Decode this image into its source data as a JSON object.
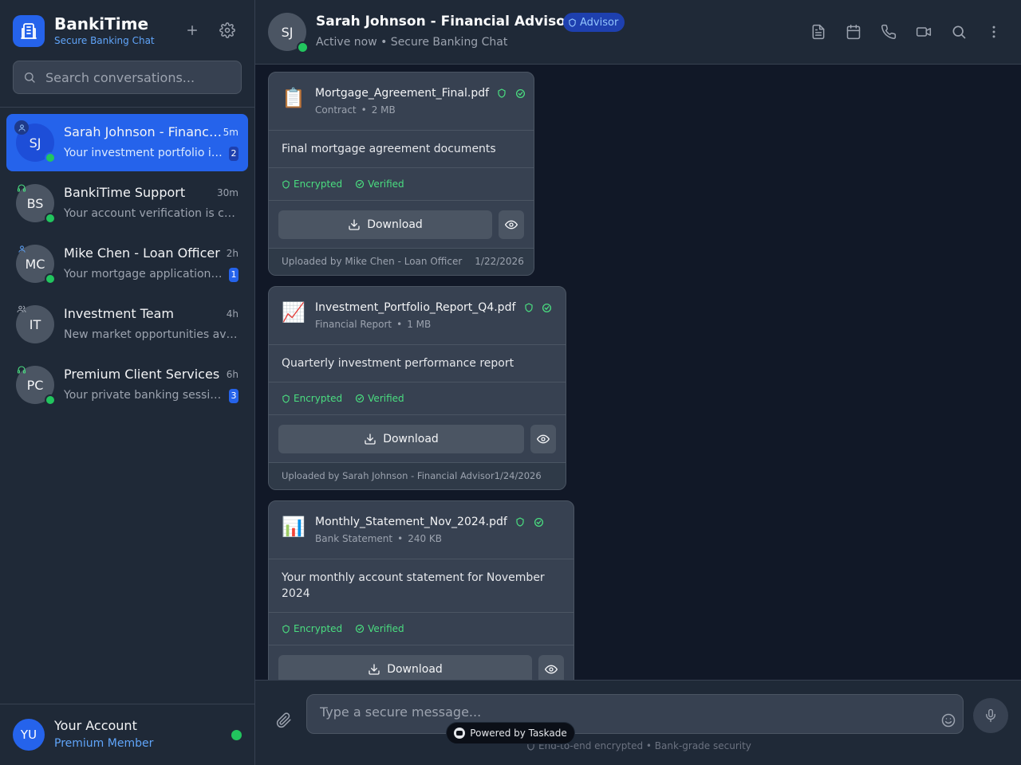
{
  "brand": {
    "name": "BankiTime",
    "subtitle": "Secure Banking Chat"
  },
  "search": {
    "placeholder": "Search conversations..."
  },
  "conversations": [
    {
      "initials": "SJ",
      "name": "Sarah Johnson - Financial Advisor",
      "time": "5m",
      "preview": "Your investment portfolio is performing well",
      "unread": "2",
      "role_icon": "user-icon",
      "online": true,
      "active": true
    },
    {
      "initials": "BS",
      "name": "BankiTime Support",
      "time": "30m",
      "preview": "Your account verification is complete",
      "unread": "",
      "role_icon": "headset-icon",
      "online": true,
      "active": false
    },
    {
      "initials": "MC",
      "name": "Mike Chen - Loan Officer",
      "time": "2h",
      "preview": "Your mortgage application has been received",
      "unread": "1",
      "role_icon": "user-icon",
      "online": true,
      "active": false
    },
    {
      "initials": "IT",
      "name": "Investment Team",
      "time": "4h",
      "preview": "New market opportunities available",
      "unread": "",
      "role_icon": "users-icon",
      "online": false,
      "active": false
    },
    {
      "initials": "PC",
      "name": "Premium Client Services",
      "time": "6h",
      "preview": "Your private banking session is scheduled",
      "unread": "3",
      "role_icon": "headset-icon",
      "online": true,
      "active": false
    }
  ],
  "account": {
    "initials": "YU",
    "name": "Your Account",
    "tier": "Premium Member"
  },
  "chat": {
    "initials": "SJ",
    "title": "Sarah Johnson - Financial Advisor",
    "tag": "Advisor",
    "status": "Active now • Secure Banking Chat",
    "actions": [
      "document-icon",
      "calendar-icon",
      "phone-icon",
      "video-icon",
      "search-icon",
      "more-vertical-icon"
    ]
  },
  "files": [
    {
      "icon": "📋",
      "name": "Mortgage_Agreement_Final.pdf",
      "type": "Contract",
      "size": "2 MB",
      "description": "Final mortgage agreement documents",
      "encrypted": "Encrypted",
      "verified": "Verified",
      "download": "Download",
      "uploader": "Uploaded by Mike Chen - Loan Officer",
      "date": "1/22/2026"
    },
    {
      "icon": "📈",
      "name": "Investment_Portfolio_Report_Q4.pdf",
      "type": "Financial Report",
      "size": "1 MB",
      "description": "Quarterly investment performance report",
      "encrypted": "Encrypted",
      "verified": "Verified",
      "download": "Download",
      "uploader": "Uploaded by Sarah Johnson - Financial Advisor",
      "date": "1/24/2026"
    },
    {
      "icon": "📊",
      "name": "Monthly_Statement_Nov_2024.pdf",
      "type": "Bank Statement",
      "size": "240 KB",
      "description": "Your monthly account statement for November 2024",
      "encrypted": "Encrypted",
      "verified": "Verified",
      "download": "Download",
      "uploader": "",
      "date": ""
    }
  ],
  "composer": {
    "placeholder": "Type a secure message...",
    "security_note": "End-to-end encrypted • Bank-grade security"
  },
  "powered_by": "Powered by Taskade",
  "colors": {
    "accent": "#2563eb",
    "online": "#22c55e",
    "secure": "#4ade80",
    "sidebar": "#1f2937",
    "background": "#111827"
  }
}
